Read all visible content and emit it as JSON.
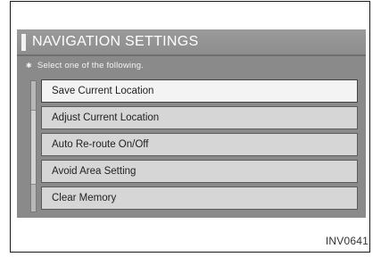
{
  "screen": {
    "title": "NAVIGATION SETTINGS",
    "instruction": "Select one of the following.",
    "menu_items": [
      {
        "label": "Save Current Location",
        "selected": true
      },
      {
        "label": "Adjust Current Location",
        "selected": false
      },
      {
        "label": "Auto Re-route On/Off",
        "selected": false
      },
      {
        "label": "Avoid Area Setting",
        "selected": false
      },
      {
        "label": "Clear Memory",
        "selected": false
      }
    ]
  },
  "figure_code": "INV0641",
  "colors": {
    "screen_bg": "#8a8a8a",
    "button_bg": "#d6d6d6",
    "button_selected_bg": "#f3f3f3",
    "title_text": "#ffffff"
  }
}
